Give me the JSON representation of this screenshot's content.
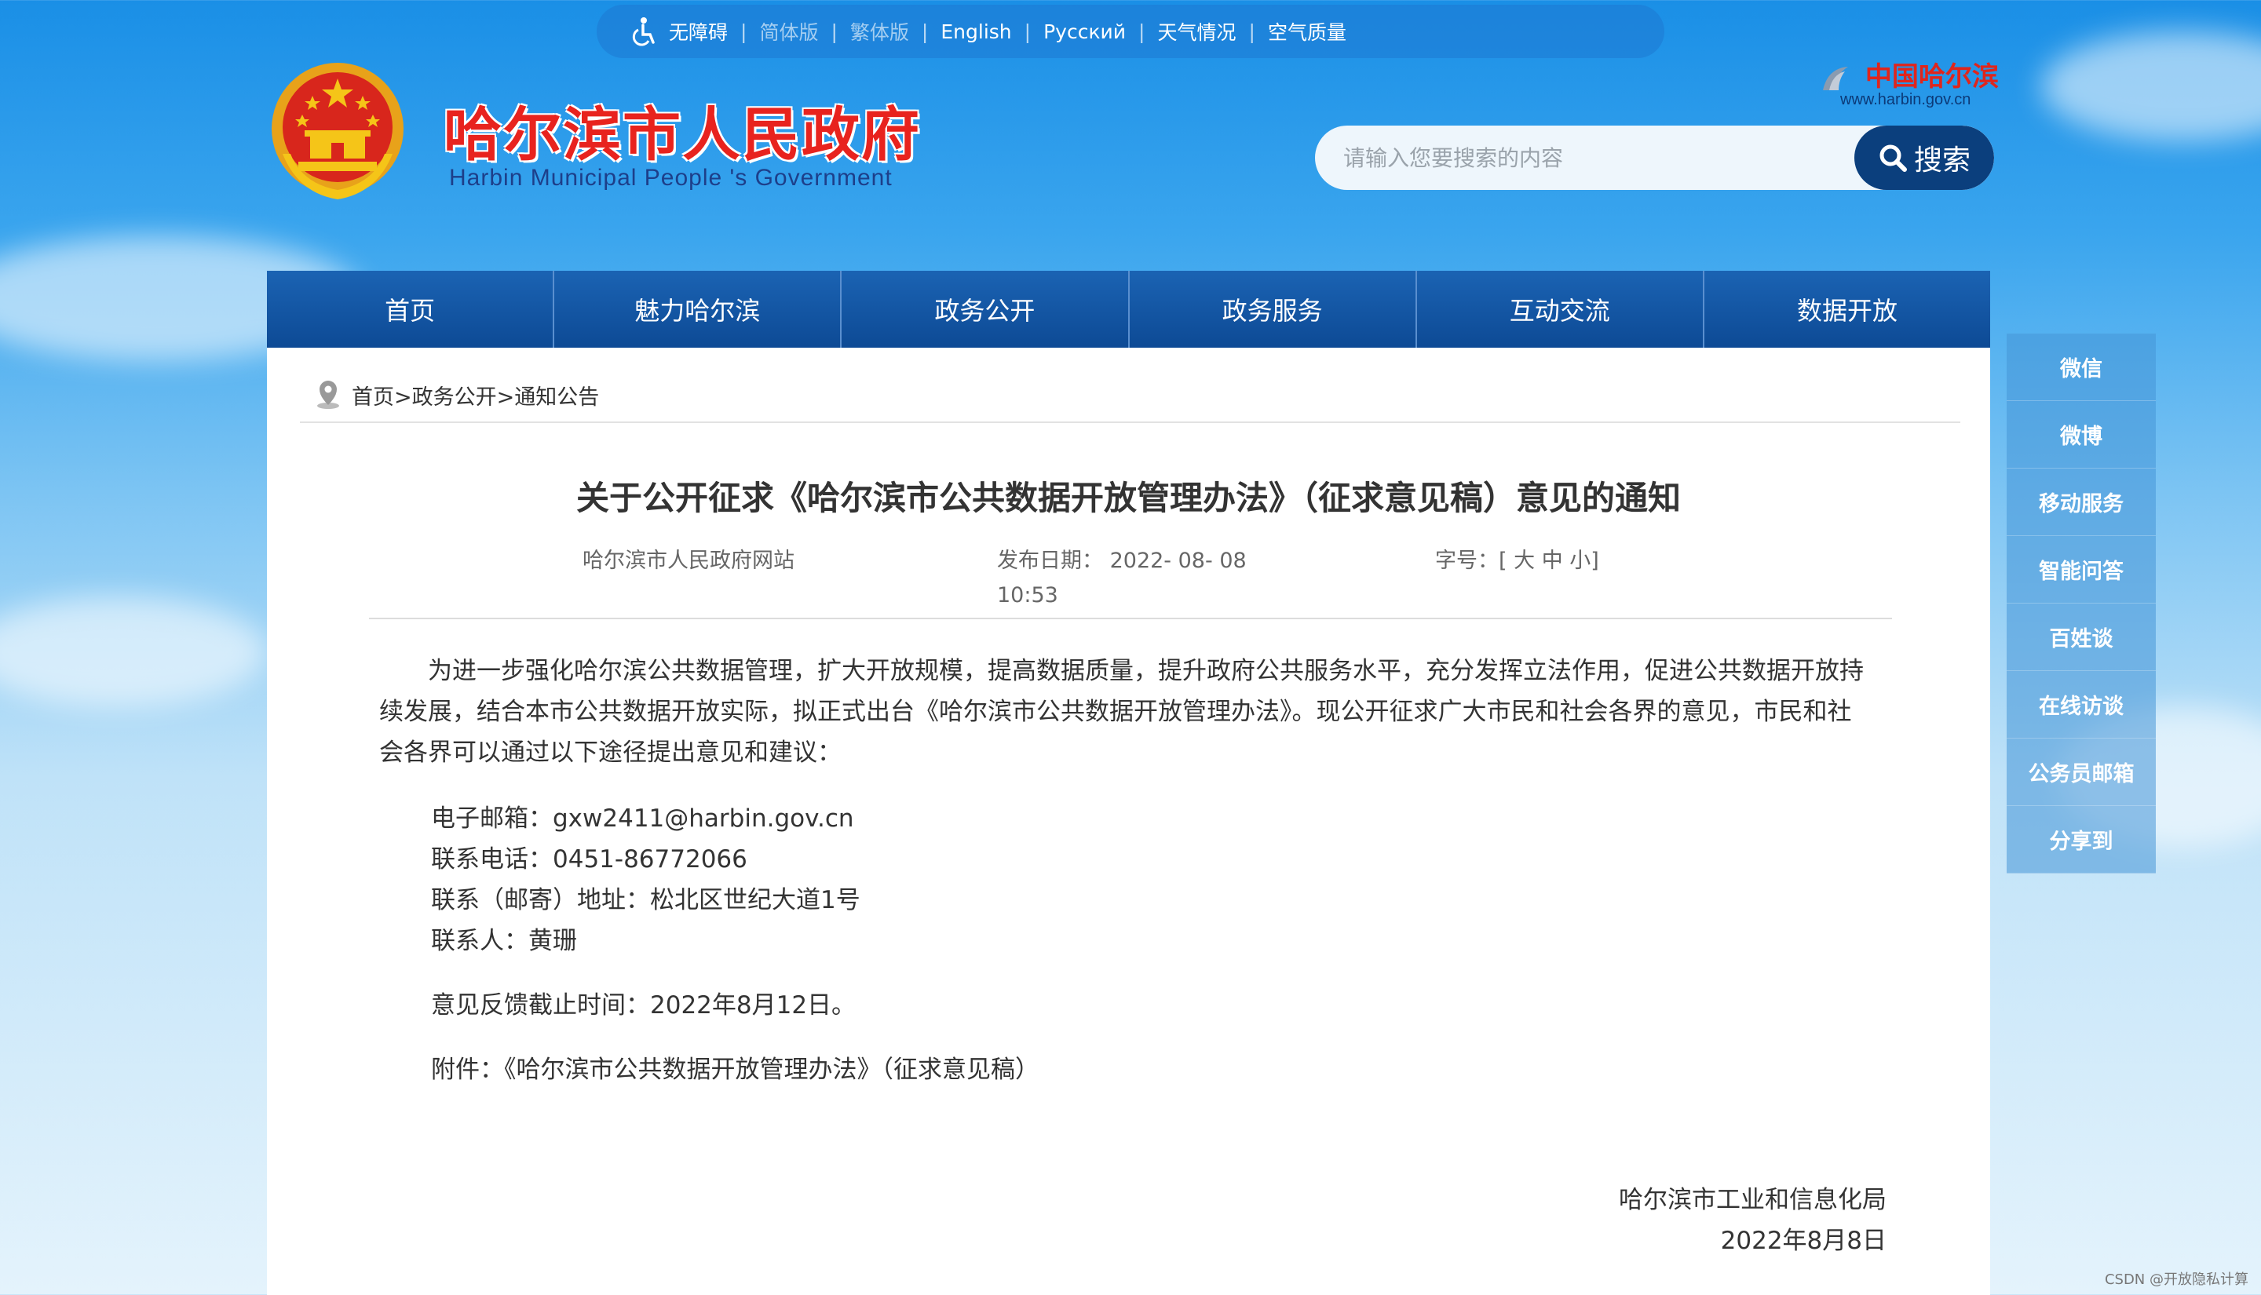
{
  "topbar": {
    "accessibility": "无障碍",
    "simplified": "简体版",
    "traditional": "繁体版",
    "english": "English",
    "russian": "Русский",
    "weather": "天气情况",
    "air": "空气质量"
  },
  "header": {
    "title": "哈尔滨市人民政府",
    "subtitle": "Harbin Municipal People 's Government",
    "brand_name": "中国哈尔滨",
    "brand_url": "www.harbin.gov.cn",
    "search_placeholder": "请输入您要搜索的内容",
    "search_label": "搜索"
  },
  "nav": {
    "items": [
      "首页",
      "魅力哈尔滨",
      "政务公开",
      "政务服务",
      "互动交流",
      "数据开放"
    ]
  },
  "breadcrumb": "首页>政务公开>通知公告",
  "article": {
    "title": "关于公开征求《哈尔滨市公共数据开放管理办法》（征求意见稿）意见的通知",
    "source": "哈尔滨市人民政府网站",
    "date_label": "发布日期：",
    "date_value": "2022- 08- 08",
    "time_value": "10:53",
    "font_label": "字号：[ 大 中 小]",
    "paragraph": "为进一步强化哈尔滨公共数据管理，扩大开放规模，提高数据质量，提升政府公共服务水平，充分发挥立法作用，促进公共数据开放持续发展，结合本市公共数据开放实际，拟正式出台《哈尔滨市公共数据开放管理办法》。现公开征求广大市民和社会各界的意见，市民和社会各界可以通过以下途径提出意见和建议：",
    "email": "电子邮箱：gxw2411@harbin.gov.cn",
    "phone": "联系电话：0451-86772066",
    "address": "联系（邮寄）地址：松北区世纪大道1号",
    "contact": "联系人：黄珊",
    "deadline": "意见反馈截止时间：2022年8月12日。",
    "attachment": "附件：《哈尔滨市公共数据开放管理办法》（征求意见稿）",
    "signer": "哈尔滨市工业和信息化局",
    "sign_date": "2022年8月8日"
  },
  "side": {
    "items": [
      "微信",
      "微博",
      "移动服务",
      "智能问答",
      "百姓谈",
      "在线访谈",
      "公务员邮箱",
      "分享到"
    ]
  },
  "watermark": "CSDN @开放隐私计算",
  "colors": {
    "nav_bg": "#0d4a95",
    "title_red": "#e8231e",
    "search_btn": "#0b3f7d"
  }
}
